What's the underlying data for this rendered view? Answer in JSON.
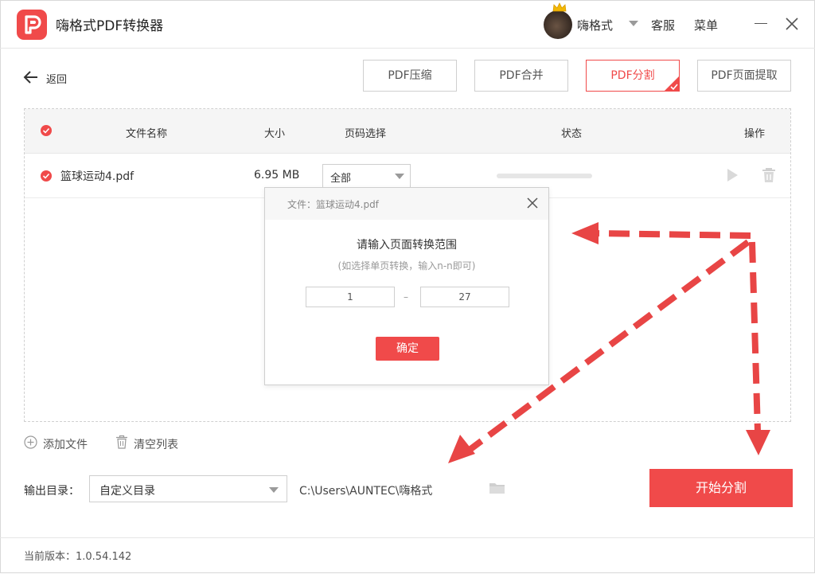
{
  "app": {
    "title": "嗨格式PDF转换器",
    "username": "嗨格式",
    "service_label": "客服",
    "menu_label": "菜单"
  },
  "toolbar": {
    "back_label": "返回",
    "tabs": [
      {
        "label": "PDF压缩",
        "active": false
      },
      {
        "label": "PDF合并",
        "active": false
      },
      {
        "label": "PDF分割",
        "active": true
      },
      {
        "label": "PDF页面提取",
        "active": false
      }
    ]
  },
  "table": {
    "headers": {
      "file_name": "文件名称",
      "size": "大小",
      "page_select": "页码选择",
      "status": "状态",
      "action": "操作"
    },
    "rows": [
      {
        "file_name": "篮球运动4.pdf",
        "size": "6.95 MB",
        "page_select": "全部",
        "progress": 0
      }
    ]
  },
  "dialog": {
    "file_label": "文件：篮球运动4.pdf",
    "title": "请输入页面转换范围",
    "hint": "(如选择单页转换，输入n-n即可)",
    "range_from": "1",
    "range_to": "27",
    "range_sep": "–",
    "confirm_label": "确定"
  },
  "bottom": {
    "add_file_label": "添加文件",
    "clear_list_label": "清空列表",
    "output_label": "输出目录：",
    "output_option": "自定义目录",
    "output_path": "C:\\Users\\AUNTEC\\嗨格式",
    "start_label": "开始分割"
  },
  "footer": {
    "version_label": "当前版本：1.0.54.142"
  },
  "colors": {
    "accent": "#f04a4a",
    "border": "#cfcfcf",
    "header_bg": "#f5f5f5"
  },
  "icons": [
    "pdf-logo-icon",
    "crown-icon",
    "chevron-down-icon",
    "minimize-icon",
    "close-icon",
    "arrow-left-icon",
    "check-icon",
    "play-icon",
    "trash-icon",
    "plus-circle-icon",
    "folder-icon"
  ]
}
